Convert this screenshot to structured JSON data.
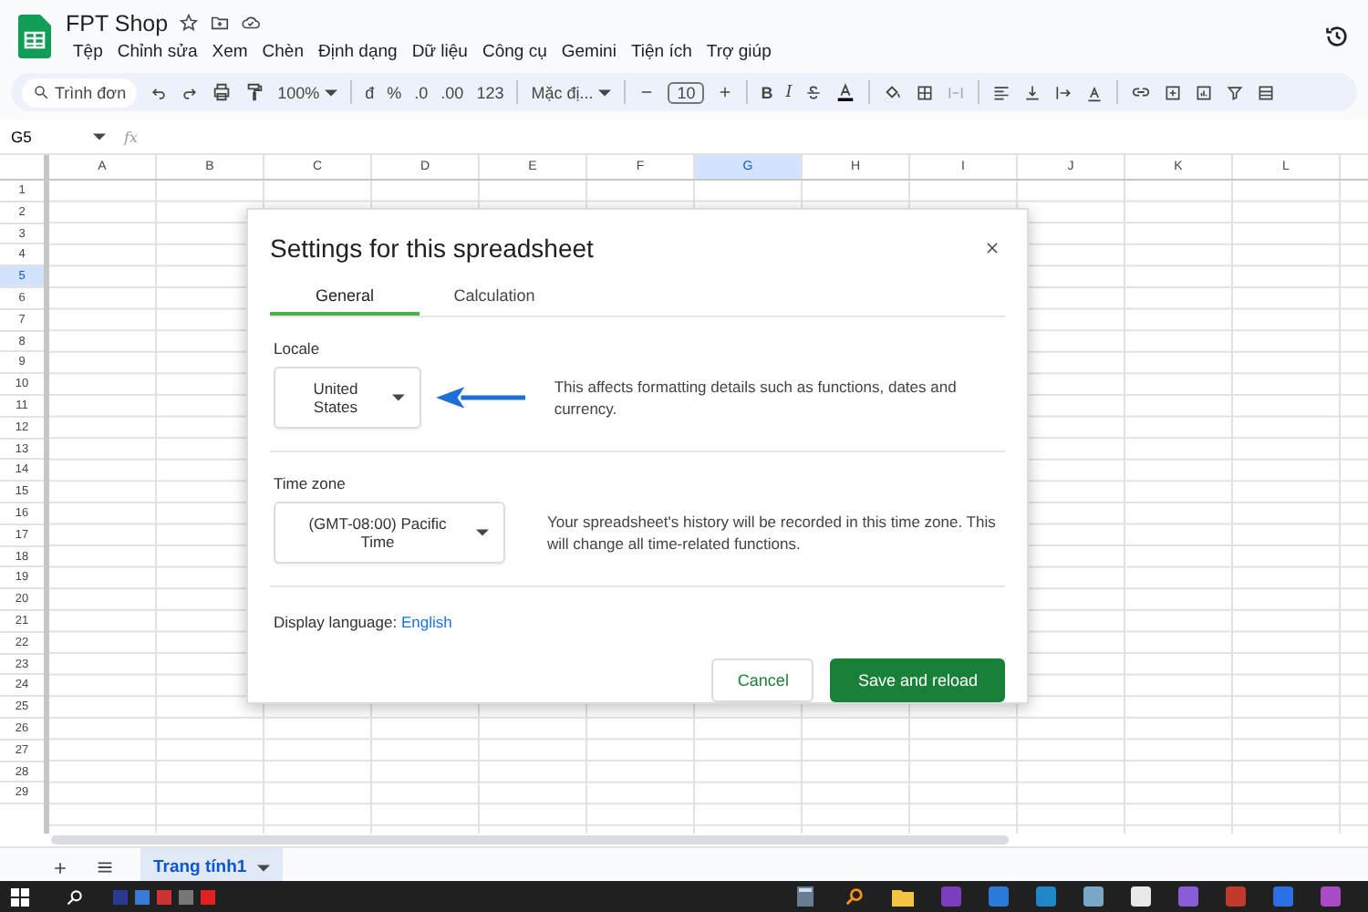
{
  "document": {
    "title": "FPT Shop"
  },
  "menu": [
    "Tệp",
    "Chỉnh sửa",
    "Xem",
    "Chèn",
    "Định dạng",
    "Dữ liệu",
    "Công cụ",
    "Gemini",
    "Tiện ích",
    "Trợ giúp"
  ],
  "toolbar": {
    "search": "Trình đơn",
    "zoom": "100%",
    "currency": "đ",
    "percent": "%",
    "decrease_decimal": ".0",
    "increase_decimal": ".00",
    "number_format": "123",
    "font": "Mặc đị...",
    "font_size": "10",
    "bold": "B",
    "italic": "I"
  },
  "formula_bar": {
    "cell_ref": "G5",
    "fx": "fx"
  },
  "columns": [
    {
      "label": "A",
      "selected": false
    },
    {
      "label": "B",
      "selected": false
    },
    {
      "label": "C",
      "selected": false
    },
    {
      "label": "D",
      "selected": false
    },
    {
      "label": "E",
      "selected": false
    },
    {
      "label": "F",
      "selected": false
    },
    {
      "label": "G",
      "selected": true
    },
    {
      "label": "H",
      "selected": false
    },
    {
      "label": "I",
      "selected": false
    },
    {
      "label": "J",
      "selected": false
    },
    {
      "label": "K",
      "selected": false
    },
    {
      "label": "L",
      "selected": false
    }
  ],
  "rows": [
    {
      "label": "1",
      "selected": false
    },
    {
      "label": "2",
      "selected": false
    },
    {
      "label": "3",
      "selected": false
    },
    {
      "label": "4",
      "selected": false
    },
    {
      "label": "5",
      "selected": true
    },
    {
      "label": "6",
      "selected": false
    },
    {
      "label": "7",
      "selected": false
    },
    {
      "label": "8",
      "selected": false
    },
    {
      "label": "9",
      "selected": false
    },
    {
      "label": "10",
      "selected": false
    },
    {
      "label": "11",
      "selected": false
    },
    {
      "label": "12",
      "selected": false
    },
    {
      "label": "13",
      "selected": false
    },
    {
      "label": "14",
      "selected": false
    },
    {
      "label": "15",
      "selected": false
    },
    {
      "label": "16",
      "selected": false
    },
    {
      "label": "17",
      "selected": false
    },
    {
      "label": "18",
      "selected": false
    },
    {
      "label": "19",
      "selected": false
    },
    {
      "label": "20",
      "selected": false
    },
    {
      "label": "21",
      "selected": false
    },
    {
      "label": "22",
      "selected": false
    },
    {
      "label": "23",
      "selected": false
    },
    {
      "label": "24",
      "selected": false
    },
    {
      "label": "25",
      "selected": false
    },
    {
      "label": "26",
      "selected": false
    },
    {
      "label": "27",
      "selected": false
    },
    {
      "label": "28",
      "selected": false
    },
    {
      "label": "29",
      "selected": false
    }
  ],
  "dialog": {
    "title": "Settings for this spreadsheet",
    "tabs": [
      {
        "label": "General",
        "selected": true
      },
      {
        "label": "Calculation",
        "selected": false
      }
    ],
    "locale": {
      "label": "Locale",
      "value": "United States",
      "description": "This affects formatting details such as functions, dates and currency."
    },
    "time_zone": {
      "label": "Time zone",
      "value": "(GMT-08:00) Pacific Time",
      "description": "Your spreadsheet's history will be recorded in this time zone. This will change all time-related functions."
    },
    "display_language": {
      "label": "Display language:",
      "value": "English"
    },
    "buttons": {
      "cancel": "Cancel",
      "save": "Save and reload"
    }
  },
  "sheet_tabs": [
    {
      "label": "Trang tính1",
      "selected": true
    }
  ]
}
